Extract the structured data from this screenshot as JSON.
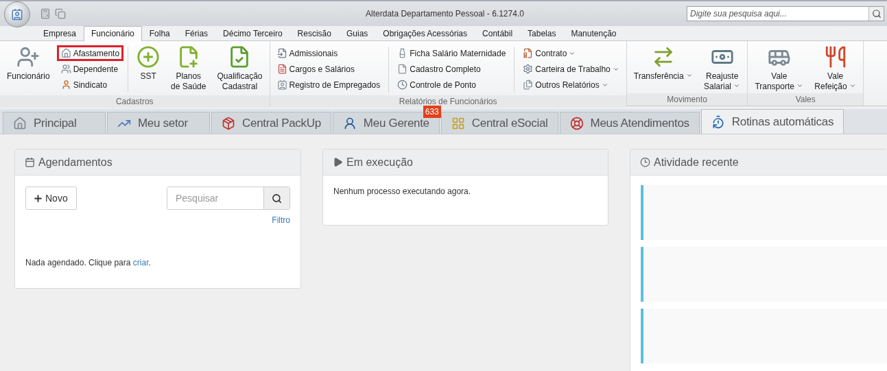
{
  "window": {
    "title": "Alterdata Departamento Pessoal - 6.1274.0"
  },
  "search": {
    "placeholder": "Digite sua pesquisa aqui..."
  },
  "menu_tabs": [
    {
      "label": "Empresa",
      "selected": false
    },
    {
      "label": "Funcionário",
      "selected": true
    },
    {
      "label": "Folha",
      "selected": false
    },
    {
      "label": "Férias",
      "selected": false
    },
    {
      "label": "Décimo Terceiro",
      "selected": false
    },
    {
      "label": "Rescisão",
      "selected": false
    },
    {
      "label": "Guias",
      "selected": false
    },
    {
      "label": "Obrigações Acessórias",
      "selected": false
    },
    {
      "label": "Contábil",
      "selected": false
    },
    {
      "label": "Tabelas",
      "selected": false
    },
    {
      "label": "Manutenção",
      "selected": false
    }
  ],
  "ribbon_groups": [
    {
      "title": "Cadastros",
      "columns": [
        {
          "kind": "large",
          "label": "Funcionário",
          "dropdown": false
        },
        {
          "kind": "stack",
          "items": [
            {
              "label": "Afastamento",
              "highlighted": true,
              "dropdown": false
            },
            {
              "label": "Dependente",
              "highlighted": false,
              "dropdown": false
            },
            {
              "label": "Sindicato",
              "highlighted": false,
              "dropdown": false
            }
          ]
        },
        {
          "kind": "separator"
        },
        {
          "kind": "large",
          "label": "SST",
          "dropdown": false
        },
        {
          "kind": "large",
          "label": "Planos\nde Saúde",
          "dropdown": false
        },
        {
          "kind": "large",
          "label": "Qualificação\nCadastral",
          "dropdown": false
        }
      ]
    },
    {
      "title": "Relatórios de Funcionários",
      "columns": [
        {
          "kind": "stack",
          "items": [
            {
              "label": "Admissionais",
              "highlighted": false,
              "dropdown": false
            },
            {
              "label": "Cargos e Salários",
              "highlighted": false,
              "dropdown": false
            },
            {
              "label": "Registro de Empregados",
              "highlighted": false,
              "dropdown": false
            }
          ]
        },
        {
          "kind": "separator"
        },
        {
          "kind": "stack",
          "items": [
            {
              "label": "Ficha Salário Maternidade",
              "highlighted": false,
              "dropdown": false
            },
            {
              "label": "Cadastro Completo",
              "highlighted": false,
              "dropdown": false
            },
            {
              "label": "Controle de Ponto",
              "highlighted": false,
              "dropdown": false
            }
          ]
        },
        {
          "kind": "separator"
        },
        {
          "kind": "stack",
          "items": [
            {
              "label": "Contrato",
              "highlighted": false,
              "dropdown": true
            },
            {
              "label": "Carteira de Trabalho",
              "highlighted": false,
              "dropdown": true
            },
            {
              "label": "Outros Relatórios",
              "highlighted": false,
              "dropdown": true
            }
          ]
        }
      ]
    },
    {
      "title": "Movimento",
      "columns": [
        {
          "kind": "large",
          "label": "Transferência",
          "dropdown": true
        },
        {
          "kind": "large",
          "label": "Reajuste\nSalarial",
          "dropdown": true
        }
      ]
    },
    {
      "title": "Vales",
      "columns": [
        {
          "kind": "large",
          "label": "Vale\nTransporte",
          "dropdown": true
        },
        {
          "kind": "large",
          "label": "Vale\nRefeição",
          "dropdown": true
        }
      ]
    }
  ],
  "doc_tabs": [
    {
      "label": "Principal",
      "selected": false
    },
    {
      "label": "Meu setor",
      "selected": false
    },
    {
      "label": "Central PackUp",
      "selected": false
    },
    {
      "label": "Meu Gerente",
      "selected": false,
      "badge": "633"
    },
    {
      "label": "Central eSocial",
      "selected": false
    },
    {
      "label": "Meus Atendimentos",
      "selected": false
    },
    {
      "label": "Rotinas automáticas",
      "selected": true
    }
  ],
  "schedules": {
    "title": "Agendamentos",
    "new_button": "Novo",
    "search_placeholder": "Pesquisar",
    "filter_link": "Filtro",
    "empty_before": "Nada agendado. Clique para",
    "empty_link": "criar",
    "empty_after": "."
  },
  "running": {
    "title": "Em execução",
    "message": "Nenhum processo executando agora."
  },
  "recent_activity": {
    "title": "Atividade recente",
    "entries": [
      {
        "kind": "redacted"
      },
      {
        "kind": "redacted"
      },
      {
        "kind": "redacted"
      }
    ]
  }
}
